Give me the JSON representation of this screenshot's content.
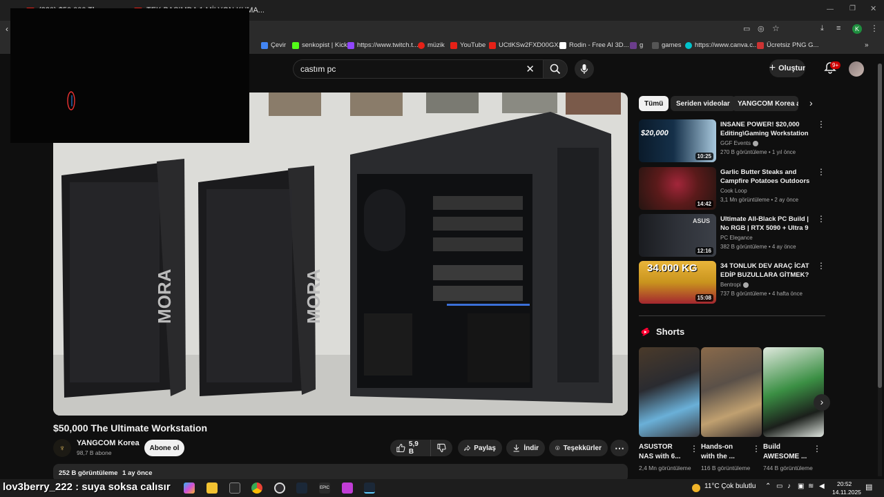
{
  "browser": {
    "tabs": [
      {
        "label": "(320) $50,000 Th..."
      },
      {
        "label": "TEK BASIMDA 1 MİLYON KUMA..."
      }
    ],
    "bookmarks": [
      {
        "label": "Çevir",
        "color": "#4285f4"
      },
      {
        "label": "senkopist | Kick",
        "color": "#53fc18"
      },
      {
        "label": "https://www.twitch.t...",
        "color": "#9146ff"
      },
      {
        "label": "müzik",
        "color": "#e62117"
      },
      {
        "label": "YouTube",
        "color": "#e62117"
      },
      {
        "label": "UCtlKSw2FXD00GX...",
        "color": "#e62117"
      },
      {
        "label": "Rodin - Free AI 3D...",
        "color": "#ffffff"
      },
      {
        "label": "g",
        "color": "#6b3d8c"
      },
      {
        "label": "games",
        "color": "#555555"
      },
      {
        "label": "https://www.canva.c...",
        "color": "#00c4cc"
      },
      {
        "label": "Ücretsiz PNG G...",
        "color": "#cc3333"
      }
    ],
    "profile_initial": "K"
  },
  "header": {
    "search_value": "castım pc",
    "create_label": "Oluştur",
    "notification_count": "9+"
  },
  "video": {
    "title": "$50,000 The Ultimate Workstation",
    "channel": "YANGCOM Korea",
    "subscribers": "98,7 B abone",
    "subscribe_label": "Abone ol",
    "likes": "5,9 B",
    "share_label": "Paylaş",
    "download_label": "İndir",
    "thanks_label": "Teşekkürler",
    "views": "252 B görüntüleme",
    "age": "1 ay önce",
    "case_brand": "MORA"
  },
  "chips": [
    "Tümü",
    "Seriden videolar",
    "YANGCOM Korea adlı..."
  ],
  "recommendations": [
    {
      "title": "INSANE POWER! $20,000 Editing\\Gaming Workstation ...",
      "channel": "GGF Events",
      "verified": true,
      "views": "270 B görüntüleme",
      "age": "1 yıl önce",
      "duration": "10:25",
      "thumb_text": "$20,000"
    },
    {
      "title": "Garlic Butter Steaks and Campfire Potatoes Outdoors",
      "channel": "Cook Loop",
      "verified": false,
      "views": "3,1 Mn görüntüleme",
      "age": "2 ay önce",
      "duration": "14:42",
      "thumb_text": ""
    },
    {
      "title": "Ultimate All-Black PC Build | No RGB | RTX 5090 + Ultra 9 285K...",
      "channel": "PC Elegance",
      "verified": false,
      "views": "382 B görüntüleme",
      "age": "4 ay önce",
      "duration": "12:16",
      "thumb_text": "ASUS"
    },
    {
      "title": "34 TONLUK DEV ARAÇ İCAT EDİP BUZULLARA GİTMEK?",
      "channel": "Bentropi",
      "verified": true,
      "views": "737 B görüntüleme",
      "age": "4 hafta önce",
      "duration": "15:08",
      "thumb_text": "34.000 KG"
    }
  ],
  "shorts": {
    "heading": "Shorts",
    "items": [
      {
        "title": "ASUSTOR NAS with 6...",
        "views": "2,4 Mn görüntüleme"
      },
      {
        "title": "Hands-on with the ...",
        "views": "116 B görüntüleme"
      },
      {
        "title": "Build AWESOME ...",
        "views": "744 B görüntüleme"
      }
    ]
  },
  "overlay": {
    "stream_chat": "lov3berry_222 : suya soksa calısır"
  },
  "taskbar": {
    "weather": "11°C  Çok bulutlu",
    "time": "20:52",
    "date": "14.11.2025"
  }
}
